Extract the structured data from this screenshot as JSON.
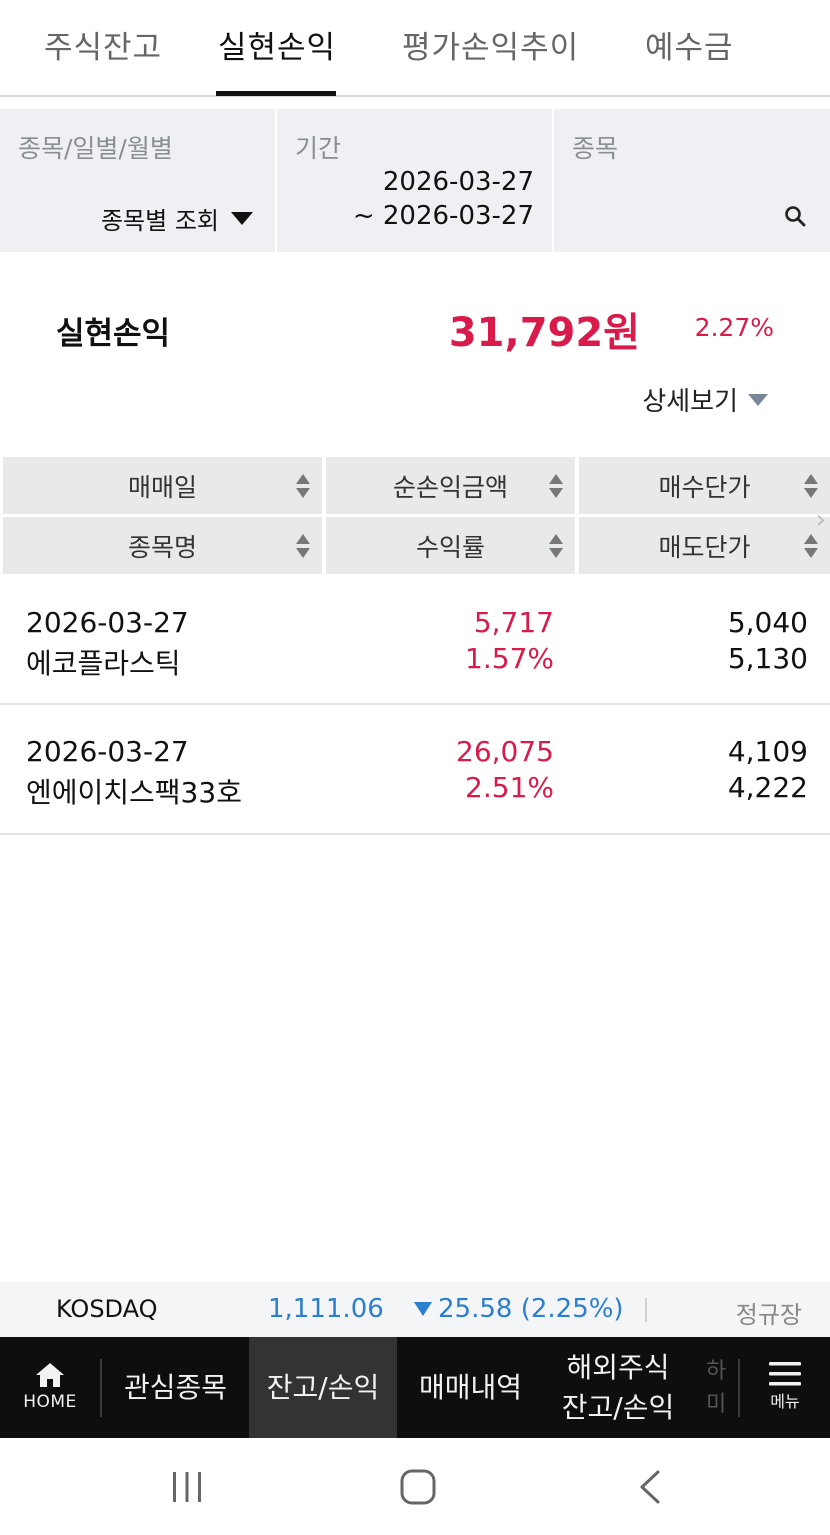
{
  "tabs": [
    {
      "label": "주식잔고",
      "active": false
    },
    {
      "label": "실현손익",
      "active": true
    },
    {
      "label": "평가손익추이",
      "active": false
    },
    {
      "label": "예수금",
      "active": false
    }
  ],
  "filters": {
    "view_label": "종목/일별/월별",
    "view_value": "종목별 조회",
    "period_label": "기간",
    "period_start": "2026-03-27",
    "period_end": "~ 2026-03-27",
    "stock_label": "종목"
  },
  "summary": {
    "label": "실현손익",
    "amount": "31,792원",
    "rate": "2.27%",
    "detail_label": "상세보기"
  },
  "table": {
    "headers": {
      "trade_date": "매매일",
      "net_profit": "순손익금액",
      "buy_price": "매수단가",
      "stock_name": "종목명",
      "return_rate": "수익률",
      "sell_price": "매도단가"
    },
    "rows": [
      {
        "date": "2026-03-27",
        "name": "에코플라스틱",
        "profit": "5,717",
        "rate": "1.57%",
        "buy": "5,040",
        "sell": "5,130"
      },
      {
        "date": "2026-03-27",
        "name": "엔에이치스팩33호",
        "profit": "26,075",
        "rate": "2.51%",
        "buy": "4,109",
        "sell": "4,222"
      }
    ]
  },
  "ticker": {
    "name": "KOSDAQ",
    "value": "1,111.06",
    "change": "25.58 (2.25%)",
    "session": "정규장"
  },
  "bottom_nav": {
    "home": "HOME",
    "watchlist": "관심종목",
    "balance": "잔고/손익",
    "trades": "매매내역",
    "overseas_line1": "해외주식",
    "overseas_line2": "잔고/손익",
    "menu": "메뉴"
  },
  "colors": {
    "profit": "#d81b4a",
    "index_down": "#2c7fce"
  }
}
